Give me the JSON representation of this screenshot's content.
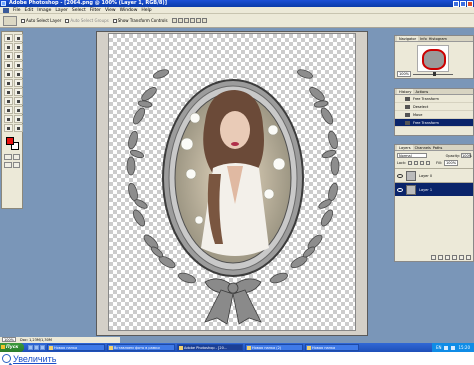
{
  "window": {
    "title": "Adobe Photoshop - [2064.png @ 100% (Layer 1, RGB/8)]"
  },
  "menu": [
    "File",
    "Edit",
    "Image",
    "Layer",
    "Select",
    "Filter",
    "View",
    "Window",
    "Help"
  ],
  "options": {
    "auto_select_layer": "Auto Select Layer",
    "auto_select_groups": "Auto Select Groups",
    "show_transform": "Show Transform Controls"
  },
  "navigator": {
    "tabs": [
      "Navigator",
      "Info",
      "Histogram"
    ],
    "zoom": "100%"
  },
  "history": {
    "tabs": [
      "History",
      "Actions"
    ],
    "items": [
      "Free Transform",
      "Deselect",
      "Move",
      "Free Transform"
    ],
    "selected_index": 3
  },
  "layers": {
    "tabs": [
      "Layers",
      "Channels",
      "Paths"
    ],
    "blend_mode": "Normal",
    "opacity_label": "Opacity:",
    "opacity": "100%",
    "lock_label": "Lock:",
    "fill_label": "Fill:",
    "fill": "100%",
    "rows": [
      {
        "name": "Layer 0",
        "selected": false
      },
      {
        "name": "Layer 1",
        "selected": true
      }
    ]
  },
  "status": {
    "zoom": "100%",
    "doc": "Doc: 1,23M/1,30M"
  },
  "taskbar": {
    "start": "Пуск",
    "tasks": [
      {
        "label": "Новая папка",
        "active": false
      },
      {
        "label": "Вставляем фото в рамки",
        "active": false
      },
      {
        "label": "Adobe Photoshop - [20...",
        "active": true
      },
      {
        "label": "Новая папка (2)",
        "active": false
      },
      {
        "label": "Новая папка",
        "active": false
      }
    ],
    "lang": "EN",
    "clock": "15:20"
  },
  "footer": {
    "link": "Увеличить"
  },
  "colors": {
    "foreground": "#e81010",
    "background": "#ffffff",
    "selection": "#0a246a"
  }
}
